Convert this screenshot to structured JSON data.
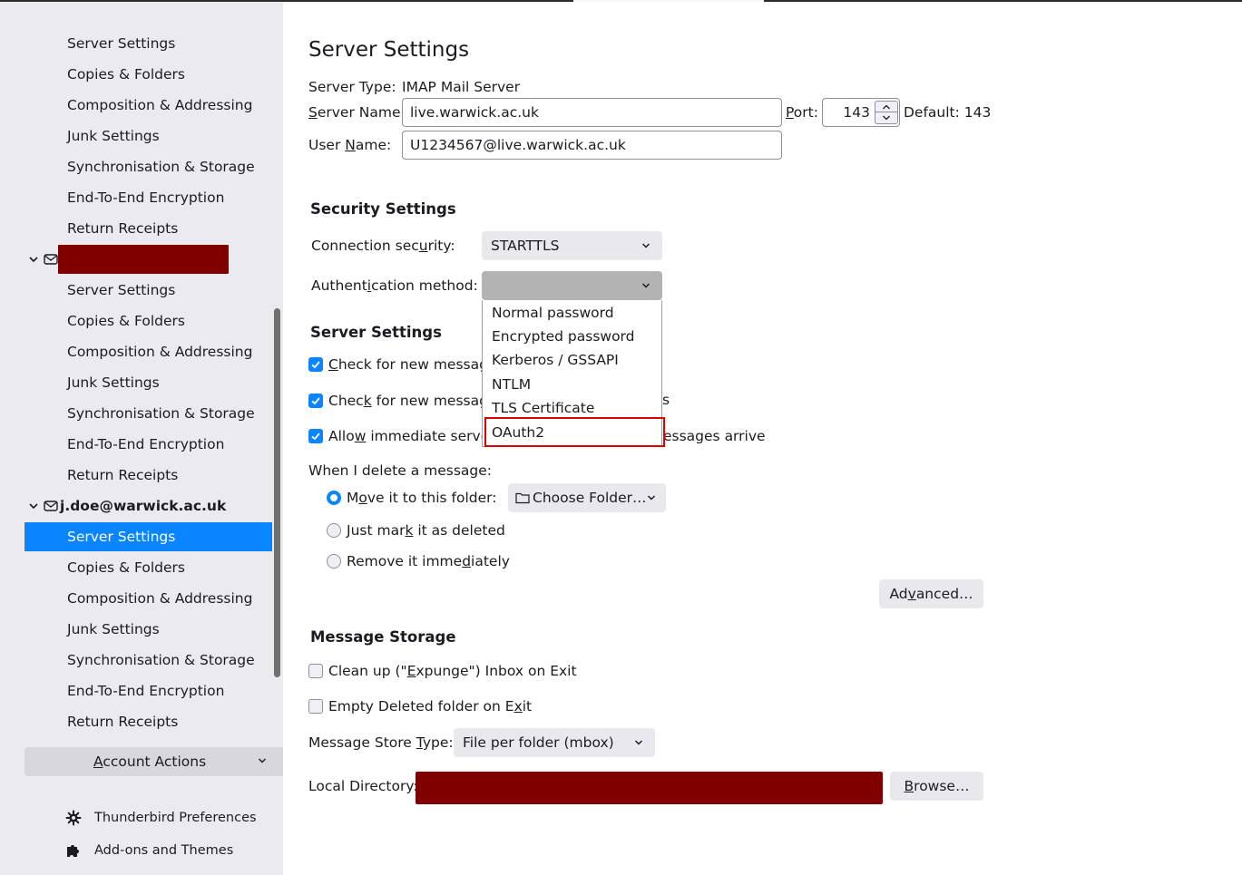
{
  "sidebar": {
    "group1_items": [
      "Server Settings",
      "Copies & Folders",
      "Composition & Addressing",
      "Junk Settings",
      "Synchronisation & Storage",
      "End-To-End Encryption",
      "Return Receipts"
    ],
    "account2": {
      "name": "[redacted]",
      "redacted": true
    },
    "group2_items": [
      "Server Settings",
      "Copies & Folders",
      "Composition & Addressing",
      "Junk Settings",
      "Synchronisation & Storage",
      "End-To-End Encryption",
      "Return Receipts"
    ],
    "account3": {
      "name": "j.doe@warwick.ac.uk"
    },
    "group3_items": [
      "Server Settings",
      "Copies & Folders",
      "Composition & Addressing",
      "Junk Settings",
      "Synchronisation & Storage",
      "End-To-End Encryption",
      "Return Receipts"
    ],
    "selected": "Server Settings",
    "account_actions": {
      "label_prefix": "",
      "label_access": "A",
      "label_rest": "ccount Actions"
    },
    "footer": [
      {
        "icon": "gear-icon",
        "label": "Thunderbird Preferences"
      },
      {
        "icon": "puzzle-icon",
        "label": "Add-ons and Themes"
      }
    ]
  },
  "main": {
    "title": "Server Settings",
    "server_type_label": "Server Type:",
    "server_type_value": "IMAP Mail Server",
    "server_name_label": {
      "access": "S",
      "rest": "erver Name:"
    },
    "server_name_value": "live.warwick.ac.uk",
    "port_label": {
      "access": "P",
      "rest": "ort:"
    },
    "port_value": "143",
    "port_default": "Default: 143",
    "user_name_label": {
      "pre": "User ",
      "access": "N",
      "rest": "ame:"
    },
    "user_name_value": "U1234567@live.warwick.ac.uk",
    "security": {
      "heading": "Security Settings",
      "connection_label": {
        "pre": "Connection sec",
        "access": "u",
        "rest": "rity:"
      },
      "connection_value": "STARTTLS",
      "auth_label": {
        "pre": "Authent",
        "access": "i",
        "rest": "cation method:"
      },
      "auth_value": "",
      "auth_options": [
        "Normal password",
        "Encrypted password",
        "Kerberos / GSSAPI",
        "NTLM",
        "TLS Certificate",
        "OAuth2"
      ],
      "auth_highlighted": "OAuth2"
    },
    "server_settings": {
      "heading": "Server Settings",
      "check1": {
        "pre": "",
        "access": "C",
        "rest": "heck for new message",
        "checked": true
      },
      "check2": {
        "pre": "Chec",
        "access": "k",
        "rest": " for new message",
        "tail": "s",
        "checked": true
      },
      "check3": {
        "pre": "Allo",
        "access": "w",
        "rest": " immediate serve",
        "tail": "essages arrive",
        "checked": true
      },
      "delete_label": "When I delete a message:",
      "radio_move": {
        "pre": "M",
        "access": "o",
        "rest": "ve it to this folder:",
        "selected": true
      },
      "choose_folder": "Choose Folder…",
      "radio_mark": {
        "pre": "Just mar",
        "access": "k",
        "rest": " it as deleted",
        "selected": false
      },
      "radio_remove": {
        "pre": "Remove it imme",
        "access": "d",
        "rest": "iately",
        "selected": false
      },
      "advanced": {
        "pre": "Ad",
        "access": "v",
        "rest": "anced…"
      }
    },
    "storage": {
      "heading": "Message Storage",
      "expunge": {
        "pre": "Clean up (\"",
        "access": "E",
        "rest": "xpunge\") Inbox on Exit",
        "checked": false
      },
      "empty_deleted": {
        "pre": "Empty Deleted folder on E",
        "access": "x",
        "rest": "it",
        "checked": false
      },
      "store_type_label": {
        "pre": "Message Store ",
        "access": "T",
        "rest": "ype:"
      },
      "store_type_value": "File per folder (mbox)",
      "local_dir_label": "Local Directory:",
      "local_dir_value": "[redacted]",
      "browse": {
        "access": "B",
        "rest": "rowse…"
      }
    }
  },
  "colors": {
    "accent": "#0a84ff",
    "redaction": "#800000",
    "highlight_box": "#e00000",
    "sidebar_bg": "#ebebef"
  }
}
